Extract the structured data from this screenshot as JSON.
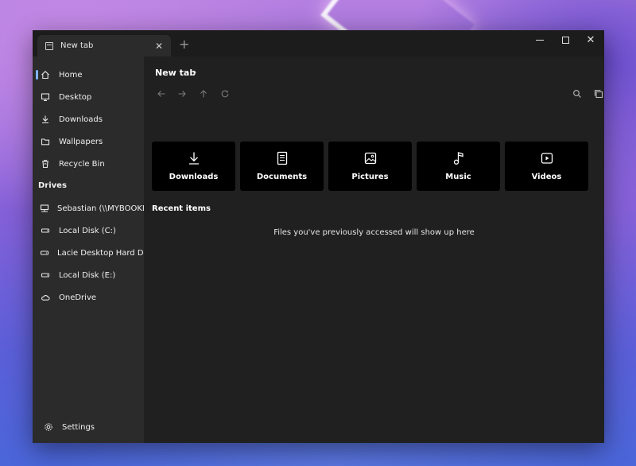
{
  "tab": {
    "label": "New tab",
    "close": "✕",
    "new_tab": "+"
  },
  "window_controls": {
    "close": "✕"
  },
  "sidebar": {
    "items": [
      {
        "label": "Home",
        "icon": "home-icon"
      },
      {
        "label": "Desktop",
        "icon": "desktop-icon"
      },
      {
        "label": "Downloads",
        "icon": "download-icon"
      },
      {
        "label": "Wallpapers",
        "icon": "folder-icon"
      },
      {
        "label": "Recycle Bin",
        "icon": "recycle-bin-icon"
      }
    ],
    "drives_heading": "Drives",
    "drives": [
      {
        "label": "Sebastian (\\\\MYBOOKLIVE",
        "icon": "network-drive-icon"
      },
      {
        "label": "Local Disk (C:)",
        "icon": "drive-icon"
      },
      {
        "label": "Lacie Desktop Hard Drive",
        "icon": "drive-icon"
      },
      {
        "label": "Local Disk (E:)",
        "icon": "drive-icon"
      },
      {
        "label": "OneDrive",
        "icon": "cloud-icon"
      }
    ],
    "settings_label": "Settings"
  },
  "main": {
    "breadcrumb": "New tab",
    "breadcrumb_chevron": "›",
    "quick_access": [
      {
        "label": "Downloads",
        "icon": "download-icon"
      },
      {
        "label": "Documents",
        "icon": "document-icon"
      },
      {
        "label": "Pictures",
        "icon": "picture-icon"
      },
      {
        "label": "Music",
        "icon": "music-icon"
      },
      {
        "label": "Videos",
        "icon": "video-icon"
      }
    ],
    "recent_title": "Recent items",
    "recent_empty": "Files you've previously accessed will show up here"
  },
  "colors": {
    "accent": "#7fb4ff",
    "sidebar": "#2b2b2b",
    "content": "#202020",
    "card": "#000000"
  }
}
